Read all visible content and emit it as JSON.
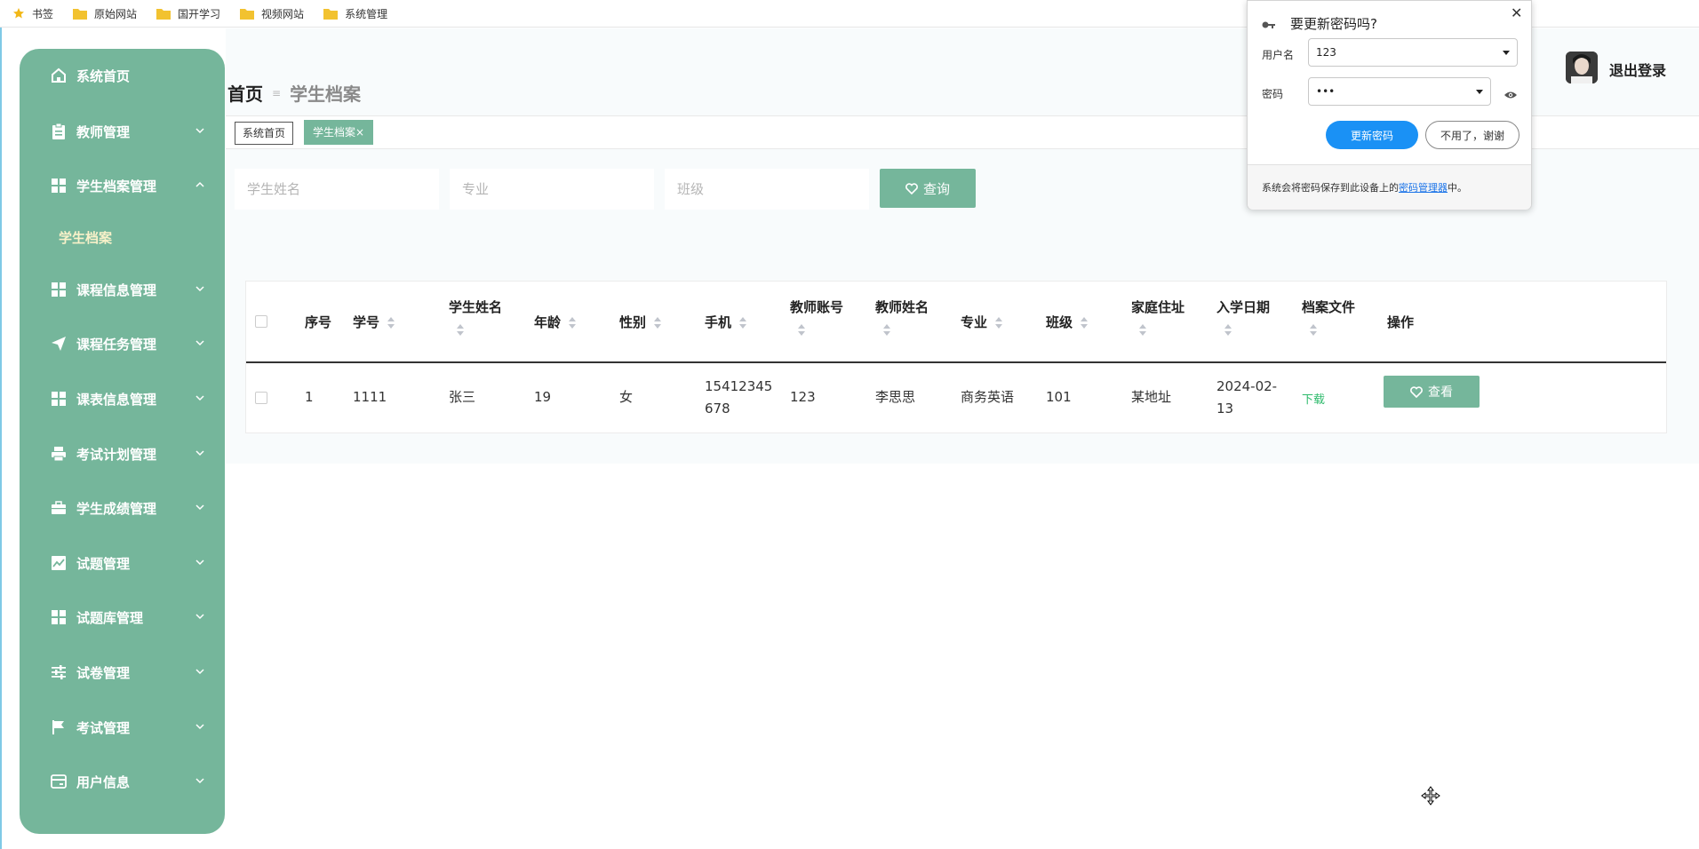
{
  "bookmarks": [
    {
      "label": "书签",
      "icon": "star-icon"
    },
    {
      "label": "原始网站",
      "icon": "folder-icon"
    },
    {
      "label": "国开学习",
      "icon": "folder-icon"
    },
    {
      "label": "视频网站",
      "icon": "folder-icon"
    },
    {
      "label": "系统管理",
      "icon": "folder-icon"
    }
  ],
  "sidebar": {
    "items": [
      {
        "label": "系统首页",
        "icon": "home-icon"
      },
      {
        "label": "教师管理",
        "icon": "clipboard-icon"
      },
      {
        "label": "学生档案管理",
        "icon": "grid-icon",
        "expanded": true
      },
      {
        "label": "课程信息管理",
        "icon": "grid-icon"
      },
      {
        "label": "课程任务管理",
        "icon": "send-icon"
      },
      {
        "label": "课表信息管理",
        "icon": "grid-icon"
      },
      {
        "label": "考试计划管理",
        "icon": "printer-icon"
      },
      {
        "label": "学生成绩管理",
        "icon": "briefcase-icon"
      },
      {
        "label": "试题管理",
        "icon": "chart-icon"
      },
      {
        "label": "试题库管理",
        "icon": "grid-icon"
      },
      {
        "label": "试卷管理",
        "icon": "sliders-icon"
      },
      {
        "label": "考试管理",
        "icon": "flag-icon"
      },
      {
        "label": "用户信息",
        "icon": "card-icon"
      }
    ],
    "sub_item": "学生档案",
    "color": "#75b69b"
  },
  "breadcrumb": {
    "home": "首页",
    "current": "学生档案"
  },
  "tabs": [
    {
      "label": "系统首页"
    },
    {
      "label": "学生档案",
      "active": true
    }
  ],
  "search": {
    "name_placeholder": "学生姓名",
    "major_placeholder": "专业",
    "class_placeholder": "班级",
    "button": "查询"
  },
  "table": {
    "headers": [
      "序号",
      "学号",
      "学生姓名",
      "年龄",
      "性别",
      "手机",
      "教师账号",
      "教师姓名",
      "专业",
      "班级",
      "家庭住址",
      "入学日期",
      "档案文件",
      "操作"
    ],
    "rows": [
      {
        "index": "1",
        "student_no": "1111",
        "name": "张三",
        "age": "19",
        "gender": "女",
        "phone_a": "15412345",
        "phone_b": "678",
        "teacher_account": "123",
        "teacher_name": "李思思",
        "major": "商务英语",
        "class": "101",
        "address": "某地址",
        "date_a": "2024-02-",
        "date_b": "13",
        "file": "下载",
        "action": "查看"
      }
    ]
  },
  "user": {
    "logout": "退出登录"
  },
  "password_popup": {
    "title": "要更新密码吗?",
    "username_label": "用户名",
    "username_value": "123",
    "password_label": "密码",
    "password_value": "•••",
    "update_button": "更新密码",
    "decline_button": "不用了，谢谢",
    "footer_prefix": "系统会将密码保存到此设备上的",
    "footer_link": "密码管理器",
    "footer_suffix": "中。"
  }
}
